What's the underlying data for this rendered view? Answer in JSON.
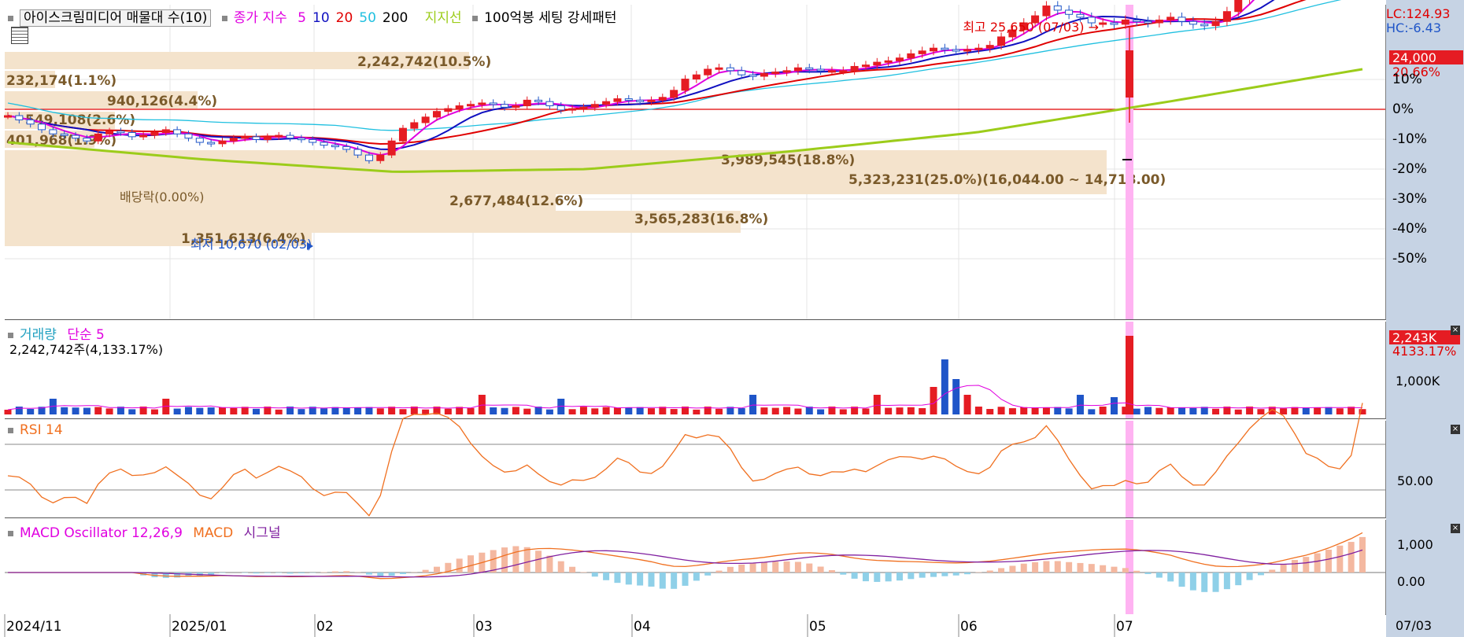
{
  "header": {
    "title": "아이스크림미디어 매물대 수(10)",
    "close_label": "종가 지수",
    "ma": [
      {
        "label": "5",
        "color": "#e000e0"
      },
      {
        "label": "10",
        "color": "#1010c0"
      },
      {
        "label": "20",
        "color": "#e00000"
      },
      {
        "label": "50",
        "color": "#20c0e0"
      },
      {
        "label": "200",
        "color": "#000000"
      }
    ],
    "support_label": "지지선",
    "pattern_label": "100억봉 세팅 강세패턴"
  },
  "price_annotations": {
    "high": "최고 25,650 (07/03)",
    "low": "최저 10,670 (02/03)",
    "dividend": "배당락(0.00%)"
  },
  "volume_profile": [
    {
      "label": "2,242,742(10.5%)"
    },
    {
      "label": "232,174(1.1%)"
    },
    {
      "label": "940,126(4.4%)"
    },
    {
      "label": "549,108(2.6%)"
    },
    {
      "label": "401,968(1.9%)"
    },
    {
      "label": "3,989,545(18.8%)"
    },
    {
      "label": "5,323,231(25.0%)(16,044.00 ~ 14,718.00)"
    },
    {
      "label": "2,677,484(12.6%)"
    },
    {
      "label": "3,565,283(16.8%)"
    },
    {
      "label": "1,351,613(6.4%)"
    }
  ],
  "right_axis": {
    "lc": "LC:124.93",
    "hc": "HC:-6.43",
    "price_badge": "24,000",
    "price_change": "20.66%",
    "pct_ticks": [
      "10%",
      "0%",
      "-10%",
      "-20%",
      "-30%",
      "-40%",
      "-50%"
    ],
    "volume_badge": "2,243K",
    "volume_pct": "4133.17%",
    "volume_tick": "1,000K",
    "rsi_tick": "50.00",
    "macd_ticks": [
      "1,000",
      "0.00"
    ],
    "date_label": "07/03"
  },
  "volume_panel": {
    "title": "거래량",
    "ma_label": "단순 5",
    "info": "2,242,742주(4,133.17%)"
  },
  "rsi_panel": {
    "title": "RSI 14"
  },
  "macd_panel": {
    "osc": "MACD Oscillator 12,26,9",
    "macd": "MACD",
    "signal": "시그널"
  },
  "x_axis": [
    "2024/11",
    "2025/01",
    "02",
    "03",
    "04",
    "05",
    "06",
    "07"
  ],
  "colors": {
    "up": "#e51c23",
    "down": "#1f55c8",
    "profile": "#f4e3cc",
    "support": "#9ccc1a",
    "highlight": "#ffb3f2"
  },
  "chart_data": {
    "type": "candlestick",
    "title": "아이스크림미디어",
    "x": [
      "2024/11",
      "2025/01",
      "02",
      "03",
      "04",
      "05",
      "06",
      "07"
    ],
    "y_pct_range": [
      -50,
      10
    ],
    "close": [
      20800,
      20500,
      20200,
      19800,
      19500,
      19400,
      19200,
      19000,
      19500,
      19700,
      19600,
      19300,
      19400,
      19600,
      19800,
      19500,
      19200,
      18900,
      18800,
      19000,
      19200,
      19300,
      19100,
      19300,
      19400,
      19200,
      19100,
      18900,
      18700,
      18600,
      18400,
      18000,
      17600,
      18000,
      19000,
      19900,
      20300,
      20700,
      21100,
      21300,
      21500,
      21600,
      21700,
      21600,
      21400,
      21500,
      21900,
      21800,
      21500,
      21200,
      21300,
      21400,
      21600,
      21800,
      22000,
      21900,
      21800,
      21900,
      22100,
      22600,
      23400,
      23700,
      24100,
      24200,
      24000,
      23700,
      23600,
      23800,
      23900,
      24000,
      24200,
      24100,
      24000,
      24000,
      24000,
      24300,
      24400,
      24600,
      24700,
      24900,
      25200,
      25400,
      25600,
      25500,
      25400,
      25500,
      25600,
      25800,
      26400,
      26900,
      27400,
      27900,
      28600,
      28300,
      28000,
      27800,
      27400,
      27400,
      27300,
      27600,
      27500,
      27400,
      27600,
      27800,
      27500,
      27300,
      27200,
      27500,
      28200,
      29100,
      30100,
      30800,
      31500,
      31900,
      32000,
      31800,
      31900,
      31700,
      31900,
      33000,
      36000
    ],
    "volume_peak": "2,242,742",
    "rsi_ref": 50,
    "series": [
      {
        "name": "5"
      },
      {
        "name": "10"
      },
      {
        "name": "20"
      },
      {
        "name": "50"
      },
      {
        "name": "200"
      }
    ]
  }
}
